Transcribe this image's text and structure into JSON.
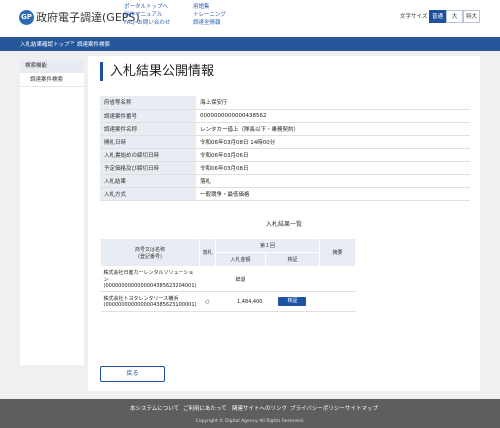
{
  "header": {
    "logo_mark": "GP",
    "title": "政府電子調達(GEPS)",
    "links_left": [
      "ポータルトップへ",
      "操作マニュアル",
      "FAQ･お問い合わせ"
    ],
    "links_right": [
      "用語集",
      "トレーニング",
      "調達全情報"
    ],
    "font_size_label": "文字サイズ",
    "font_size_options": [
      "普通",
      "大",
      "特大"
    ]
  },
  "breadcrumb": {
    "items": [
      "入札結果確認トップ",
      "調達案件検索"
    ],
    "separator": ">"
  },
  "sidebar": {
    "heading": "検索機能",
    "items": [
      "調達案件検索"
    ]
  },
  "page": {
    "title": "入札結果公開情報"
  },
  "info": [
    {
      "label": "府省等名称",
      "value": "海上保安庁"
    },
    {
      "label": "調達案件番号",
      "value": "0000000000000438562"
    },
    {
      "label": "調達案件名称",
      "value": "レンタカー借上（隊長以下・乗務契約）"
    },
    {
      "label": "開札日時",
      "value": "令和06年03月08日 14時00分"
    },
    {
      "label": "入札書始めの締切日時",
      "value": "令和06年03月06日"
    },
    {
      "label": "予定価格及び締切日時",
      "value": "令和06年03月08日"
    },
    {
      "label": "入札結果",
      "value": "落札"
    },
    {
      "label": "入札方式",
      "value": "一般競争・最低価格"
    }
  ],
  "results": {
    "title": "入札結果一覧",
    "headers": {
      "bidder": "商号又は名称\n(登記番号)",
      "winner": "落札",
      "round": "第１回",
      "amount": "入札金額",
      "remarks": "検証",
      "note": "摘要"
    },
    "rows": [
      {
        "name": "株式会社日産カーレンタルソリューション",
        "code": "(0000000000000004385623204001)",
        "winner": "",
        "amount": "辞退",
        "button": ""
      },
      {
        "name": "株式会社トヨタレンタリース横浜",
        "code": "(0000000000000004385623100001)",
        "winner": "○",
        "amount": "1,484,400",
        "button": "検証"
      }
    ]
  },
  "back_label": "戻る",
  "footer": {
    "links": [
      "本システムについて",
      "ご利用にあたって",
      "関連サイトへのリンク",
      "プライバシーポリシー",
      "サイトマップ"
    ],
    "copyright": "Copyright © Digital Agency All Rights Reserved."
  }
}
